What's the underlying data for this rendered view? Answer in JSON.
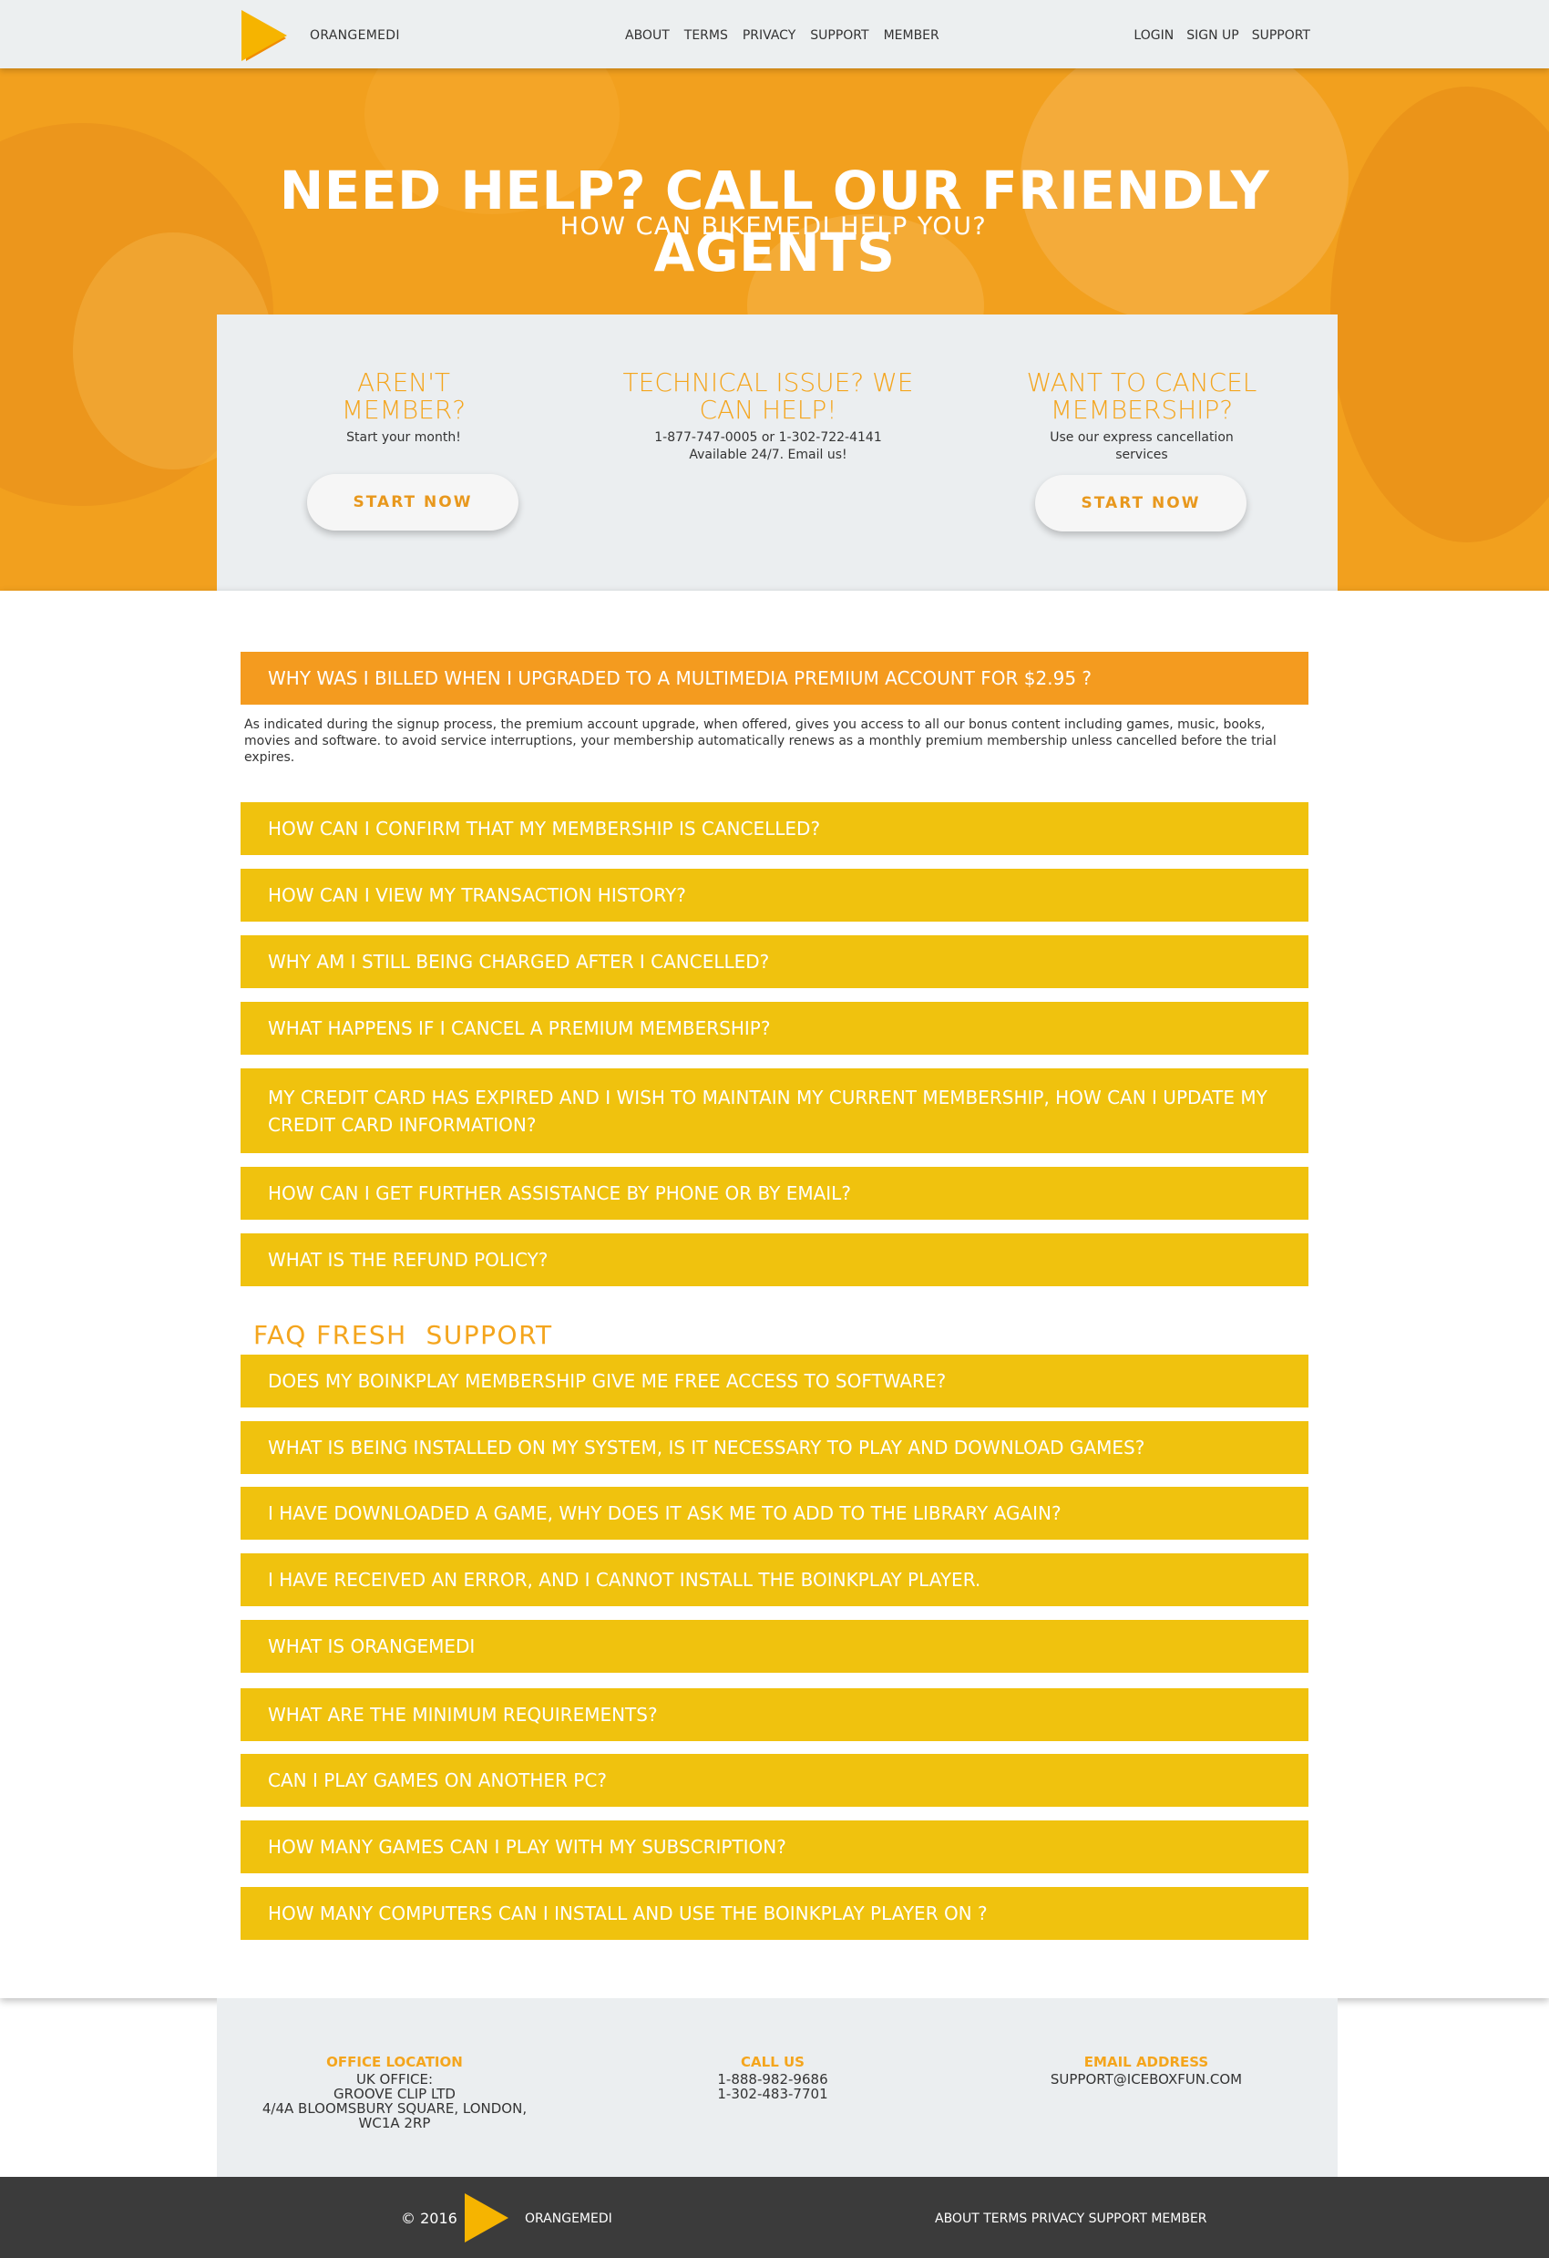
{
  "nav": {
    "brand": "ORANGEMEDI",
    "center_links": [
      "ABOUT",
      "TERMS",
      "PRIVACY",
      "SUPPORT",
      "MEMBER"
    ],
    "right_links": [
      "LOGIN",
      "SIGN UP",
      "SUPPORT"
    ]
  },
  "hero": {
    "title": "NEED HELP? CALL OUR FRIENDLY AGENTS",
    "subtitle": "HOW CAN BIKEMEDI HELP YOU?"
  },
  "cards": [
    {
      "heading": "AREN'T MEMBER?",
      "text": "Start your month!",
      "button": "START NOW"
    },
    {
      "heading": "TECHNICAL ISSUE? WE CAN HELP!",
      "text_line1": "1-877-747-0005 or 1-302-722-4141",
      "text_line2": "Available 24/7. Email us!"
    },
    {
      "heading": "WANT TO CANCEL MEMBERSHIP?",
      "text_line1": "Use our express cancellation",
      "text_line2": "services",
      "button": "START NOW"
    }
  ],
  "faq": {
    "active_question": "WHY WAS I BILLED WHEN I UPGRADED TO A MULTIMEDIA PREMIUM ACCOUNT FOR $2.95 ?",
    "active_answer": " As indicated during the signup process, the premium account upgrade, when offered, gives you access to all our bonus content including games, music,  books, movies and software. to avoid service interruptions, your membership automatically renews as a monthly premium membership unless cancelled before the trial expires.",
    "questions": [
      "HOW CAN I CONFIRM THAT MY MEMBERSHIP IS CANCELLED?",
      "HOW CAN I VIEW MY TRANSACTION HISTORY?",
      "WHY AM I STILL BEING CHARGED AFTER I CANCELLED?",
      "WHAT HAPPENS IF I CANCEL A PREMIUM MEMBERSHIP?",
      "MY CREDIT CARD HAS EXPIRED AND I WISH TO MAINTAIN MY CURRENT MEMBERSHIP, HOW CAN I UPDATE MY CREDIT CARD INFORMATION?",
      "HOW CAN I GET FURTHER ASSISTANCE BY PHONE OR BY EMAIL?",
      "WHAT IS THE REFUND POLICY?"
    ],
    "section2_title": "FAQ FRESH  SUPPORT",
    "section2_questions": [
      "DOES MY BOINKPLAY MEMBERSHIP GIVE ME FREE ACCESS TO SOFTWARE?",
      "WHAT IS BEING INSTALLED ON MY SYSTEM, IS IT NECESSARY TO PLAY AND DOWNLOAD GAMES?",
      "I HAVE DOWNLOADED A GAME, WHY DOES IT ASK ME TO ADD TO THE LIBRARY AGAIN?",
      "I HAVE RECEIVED AN ERROR, AND I CANNOT INSTALL THE BOINKPLAY PLAYER.",
      "WHAT IS ORANGEMEDI",
      "WHAT ARE THE MINIMUM REQUIREMENTS?",
      "CAN I PLAY GAMES ON ANOTHER PC?",
      "HOW MANY GAMES CAN I PLAY WITH MY SUBSCRIPTION?",
      "HOW MANY COMPUTERS CAN I INSTALL AND USE THE BOINKPLAY PLAYER ON ?"
    ]
  },
  "contact": {
    "office_heading": "OFFICE LOCATION",
    "office_lines": [
      "UK OFFICE:",
      "GROOVE CLIP LTD",
      "4/4A BLOOMSBURY SQUARE, LONDON, WC1A 2RP"
    ],
    "call_heading": "CALL US",
    "call_lines": [
      "1-888-982-9686",
      "1-302-483-7701"
    ],
    "email_heading": "EMAIL ADDRESS",
    "email": "SUPPORT@ICEBOXFUN.COM"
  },
  "footer": {
    "copyright": "© 2016",
    "brand": "ORANGEMEDI",
    "links": "ABOUT TERMS PRIVACY SUPPORT MEMBER"
  },
  "colors": {
    "accent_orange": "#f49b1f",
    "faq_yellow": "#f0c20e",
    "heading_orange": "#f4a51d",
    "panel_gray": "#ebeef0",
    "footer_dark": "#3b3b3b"
  }
}
